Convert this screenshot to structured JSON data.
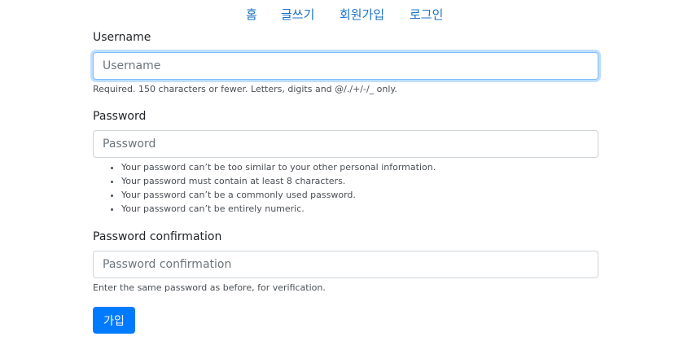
{
  "nav": {
    "home": "홈",
    "write": "글쓰기",
    "signup": "회원가입",
    "login": "로그인"
  },
  "form": {
    "username": {
      "label": "Username",
      "placeholder": "Username",
      "help": "Required. 150 characters or fewer. Letters, digits and @/./+/-/_ only."
    },
    "password": {
      "label": "Password",
      "placeholder": "Password",
      "rules": [
        "Your password can’t be too similar to your other personal information.",
        "Your password must contain at least 8 characters.",
        "Your password can’t be a commonly used password.",
        "Your password can’t be entirely numeric."
      ]
    },
    "password_confirmation": {
      "label": "Password confirmation",
      "placeholder": "Password confirmation",
      "help": "Enter the same password as before, for verification."
    },
    "submit_label": "가입"
  },
  "colors": {
    "link": "#1a73c8",
    "primary": "#007bff",
    "focus_border": "#80bdff"
  }
}
